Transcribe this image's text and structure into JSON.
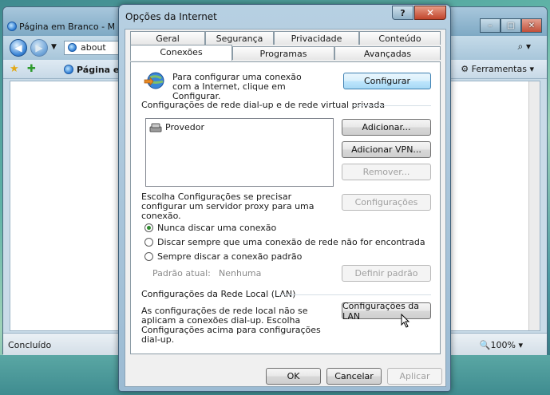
{
  "ie": {
    "title": "Página em Branco - M",
    "address": "about",
    "tab_label": "Página e",
    "tools_label": "Ferramentas",
    "status_left": "Concluído",
    "zoom": "100%"
  },
  "dialog": {
    "title": "Opções da Internet",
    "help_label": "?",
    "close_label": "✕",
    "tabs_row1": [
      "Geral",
      "Segurança",
      "Privacidade",
      "Conteúdo"
    ],
    "tabs_row2": [
      "Conexões",
      "Programas",
      "Avançadas"
    ],
    "active_tab": "Conexões",
    "setup": {
      "text": "Para configurar uma conexão com a Internet, clique em Configurar.",
      "button": "Configurar"
    },
    "dialup_group": "Configurações de rede dial-up e de rede virtual privada",
    "connections": [
      "Provedor"
    ],
    "buttons": {
      "add": "Adicionar...",
      "add_vpn": "Adicionar VPN...",
      "remove": "Remover...",
      "settings": "Configurações",
      "set_default": "Definir padrão",
      "lan_settings": "Configurações da LAN",
      "ok": "OK",
      "cancel": "Cancelar",
      "apply": "Aplicar"
    },
    "proxy_text": "Escolha Configurações se precisar configurar um servidor proxy para uma conexão.",
    "dial_options": [
      {
        "label": "Nunca discar uma conexão",
        "checked": true
      },
      {
        "label": "Discar sempre que uma conexão de rede não for encontrada",
        "checked": false
      },
      {
        "label": "Sempre discar a conexão padrão",
        "checked": false
      }
    ],
    "default_label": "Padrão atual:",
    "default_value": "Nenhuma",
    "lan_group": "Configurações da Rede Local (LAN)",
    "lan_text": "As configurações de rede local não se aplicam a conexões dial-up. Escolha Configurações acima para configurações dial-up."
  }
}
